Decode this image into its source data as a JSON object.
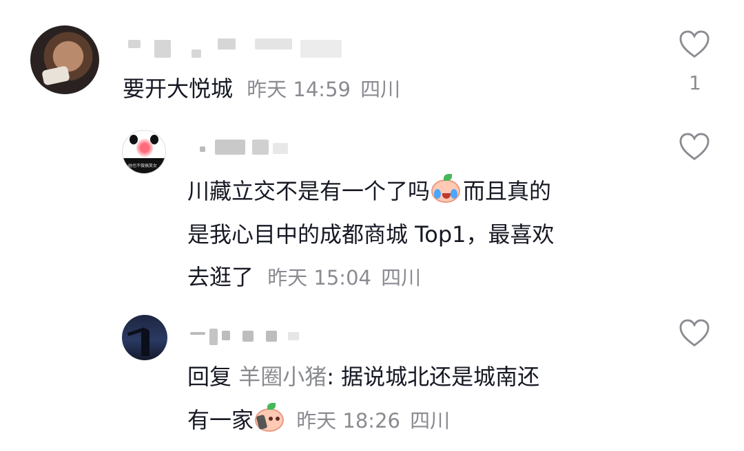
{
  "comments": [
    {
      "body": "要开大悦城",
      "time": "昨天 14:59",
      "location": "四川",
      "likes": "1"
    },
    {
      "lines": [
        "川藏立交不是有一个了吗",
        "而且真的",
        "是我心目中的成都商城 Top1，最喜欢",
        "去逛了"
      ],
      "time": "昨天 15:04",
      "location": "四川",
      "emoji_name": "crying-pig-emoji"
    },
    {
      "reply_prefix": "回复",
      "reply_to": "羊圈小猪",
      "reply_text": ": 据说城北还是城南还",
      "line2": "有一家",
      "time": "昨天 18:26",
      "location": "四川",
      "emoji_name": "phone-pig-emoji"
    }
  ],
  "avatar2_tiny_text": "她也不做搞笑女"
}
